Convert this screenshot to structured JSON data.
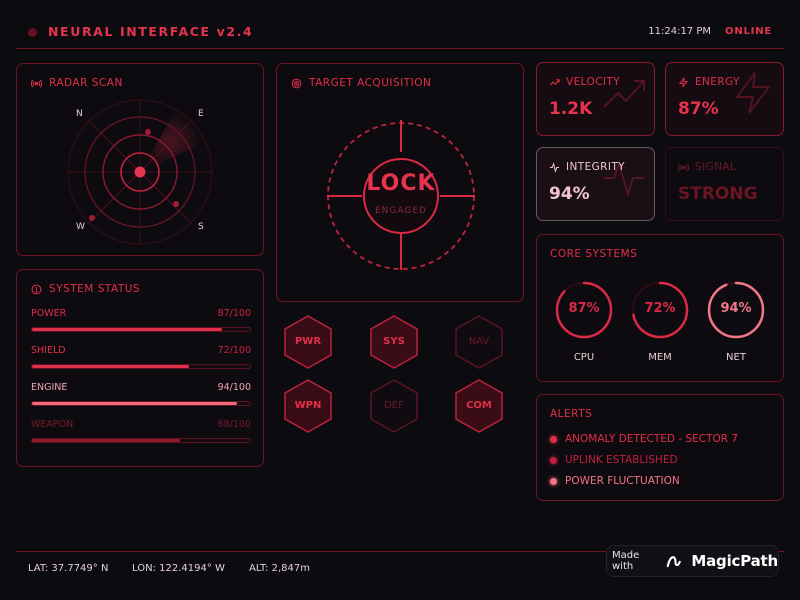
{
  "header": {
    "title": "NEURAL INTERFACE v2.4",
    "clock": "11:24:17 PM",
    "status": "ONLINE"
  },
  "radar": {
    "title": "RADAR SCAN",
    "labels": {
      "n": "N",
      "e": "E",
      "w": "W",
      "s": "S"
    }
  },
  "target": {
    "title": "TARGET ACQUISITION",
    "lock_text": "LOCK",
    "lock_sub": "ENGAGED"
  },
  "system_status": {
    "title": "SYSTEM STATUS",
    "items": [
      {
        "name": "POWER",
        "value_text": "87/100",
        "value": 87,
        "color": "#e0304a"
      },
      {
        "name": "SHIELD",
        "value_text": "72/100",
        "value": 72,
        "color": "#e0304a"
      },
      {
        "name": "ENGINE",
        "value_text": "94/100",
        "value": 94,
        "color": "#f06d7e"
      },
      {
        "name": "WEAPON",
        "value_text": "68/100",
        "value": 68,
        "color": "#8f1a2c"
      }
    ]
  },
  "hex_buttons": [
    {
      "label": "PWR",
      "active": true
    },
    {
      "label": "SYS",
      "active": true
    },
    {
      "label": "NAV",
      "active": false
    },
    {
      "label": "WPN",
      "active": true
    },
    {
      "label": "DEF",
      "active": false
    },
    {
      "label": "COM",
      "active": true
    }
  ],
  "metrics": {
    "velocity": {
      "label": "VELOCITY",
      "value": "1.2K"
    },
    "energy": {
      "label": "ENERGY",
      "value": "87%"
    },
    "integrity": {
      "label": "INTEGRITY",
      "value": "94%"
    },
    "signal": {
      "label": "SIGNAL",
      "value": "STRONG"
    }
  },
  "core_systems": {
    "title": "CORE SYSTEMS",
    "gauges": [
      {
        "label": "CPU",
        "value_text": "87%",
        "value": 87,
        "color": "#d92a45"
      },
      {
        "label": "MEM",
        "value_text": "72%",
        "value": 72,
        "color": "#d92a45"
      },
      {
        "label": "NET",
        "value_text": "94%",
        "value": 94,
        "color": "#f07888"
      }
    ]
  },
  "alerts": {
    "title": "ALERTS",
    "items": [
      {
        "text": "ANOMALY DETECTED - SECTOR 7",
        "color": "#e0304a"
      },
      {
        "text": "UPLINK ESTABLISHED",
        "color": "#c02040"
      },
      {
        "text": "POWER FLUCTUATION",
        "color": "#f27386"
      }
    ]
  },
  "footer": {
    "lat": "LAT: 37.7749° N",
    "lon": "LON: 122.4194° W",
    "alt": "ALT: 2,847m"
  },
  "badge": {
    "made_with": "Made with",
    "brand": "MagicPath"
  },
  "colors": {
    "accent": "#e0304a",
    "border": "#6e1524",
    "background": "#0b0b10"
  }
}
